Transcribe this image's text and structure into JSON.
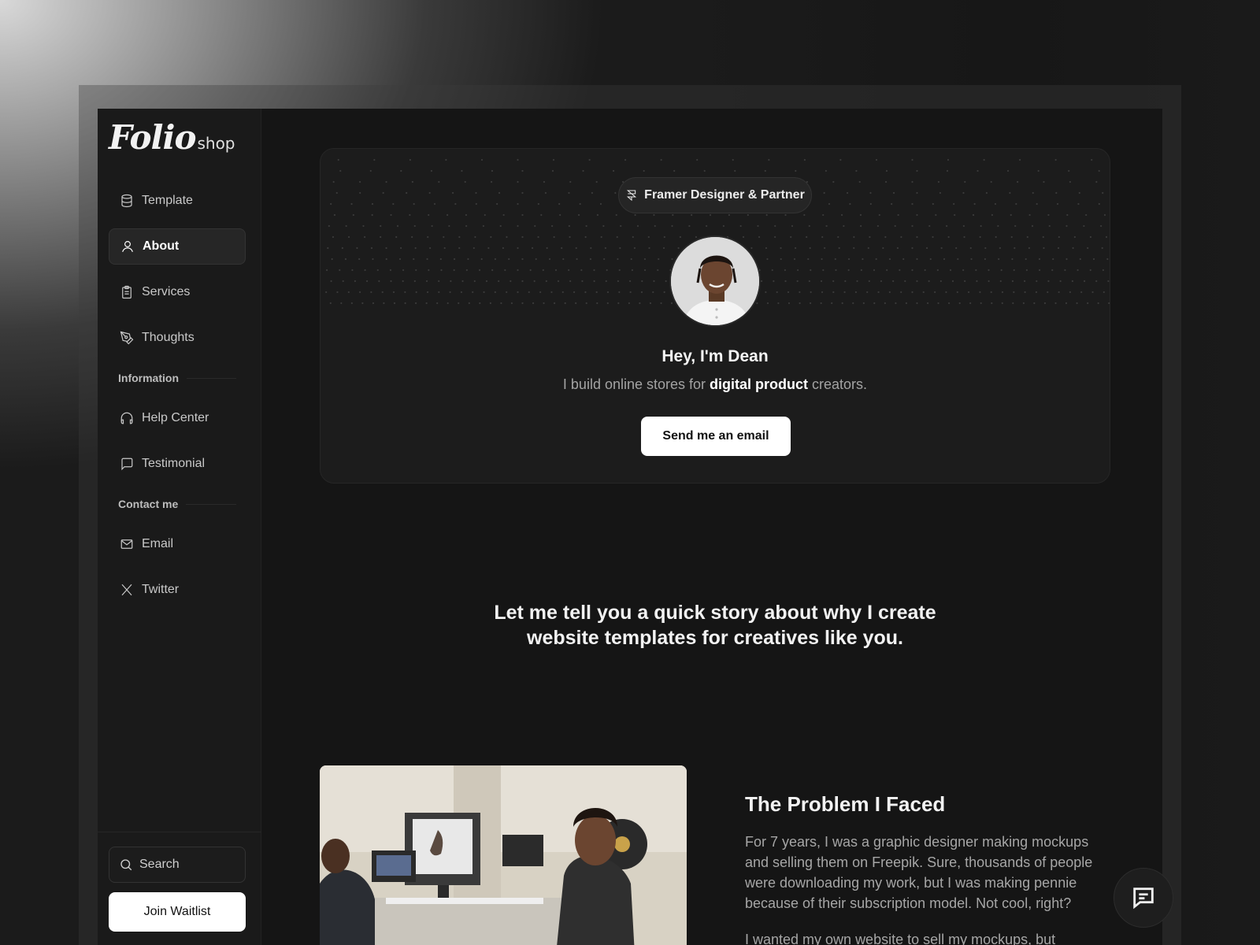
{
  "logo": {
    "main": "Folio",
    "sub": "shop"
  },
  "sidebar": {
    "items": [
      {
        "label": "Template",
        "icon": "database-icon"
      },
      {
        "label": "About",
        "icon": "user-icon",
        "active": true
      },
      {
        "label": "Services",
        "icon": "clipboard-icon"
      },
      {
        "label": "Thoughts",
        "icon": "pen-tool-icon"
      }
    ],
    "section_information": "Information",
    "info_items": [
      {
        "label": "Help Center",
        "icon": "headphones-icon"
      },
      {
        "label": "Testimonial",
        "icon": "message-square-icon"
      }
    ],
    "section_contact": "Contact me",
    "contact_items": [
      {
        "label": "Email",
        "icon": "mail-icon"
      },
      {
        "label": "Twitter",
        "icon": "x-logo-icon"
      }
    ],
    "search_label": "Search",
    "join_label": "Join Waitlist"
  },
  "hero": {
    "badge": "Framer Designer & Partner",
    "title": "Hey, I'm Dean",
    "sub_pre": "I build online stores for ",
    "sub_bold": "digital product",
    "sub_post": " creators.",
    "cta": "Send me an email"
  },
  "story": {
    "line1": "Let me tell you a quick story about why I create",
    "line2": "website templates for creatives like you."
  },
  "problem": {
    "title": "The Problem I Faced",
    "body": "For 7 years, I was a graphic designer making mockups and selling them on Freepik. Sure, thousands of people were downloading my work, but I was making pennie because of their subscription model. Not cool, right?",
    "body2": "I wanted my own website to sell my mockups, but"
  },
  "colors": {
    "background": "#151515",
    "sidebar": "#1a1a1a",
    "card": "#1c1c1c",
    "accent": "#ffffff"
  }
}
